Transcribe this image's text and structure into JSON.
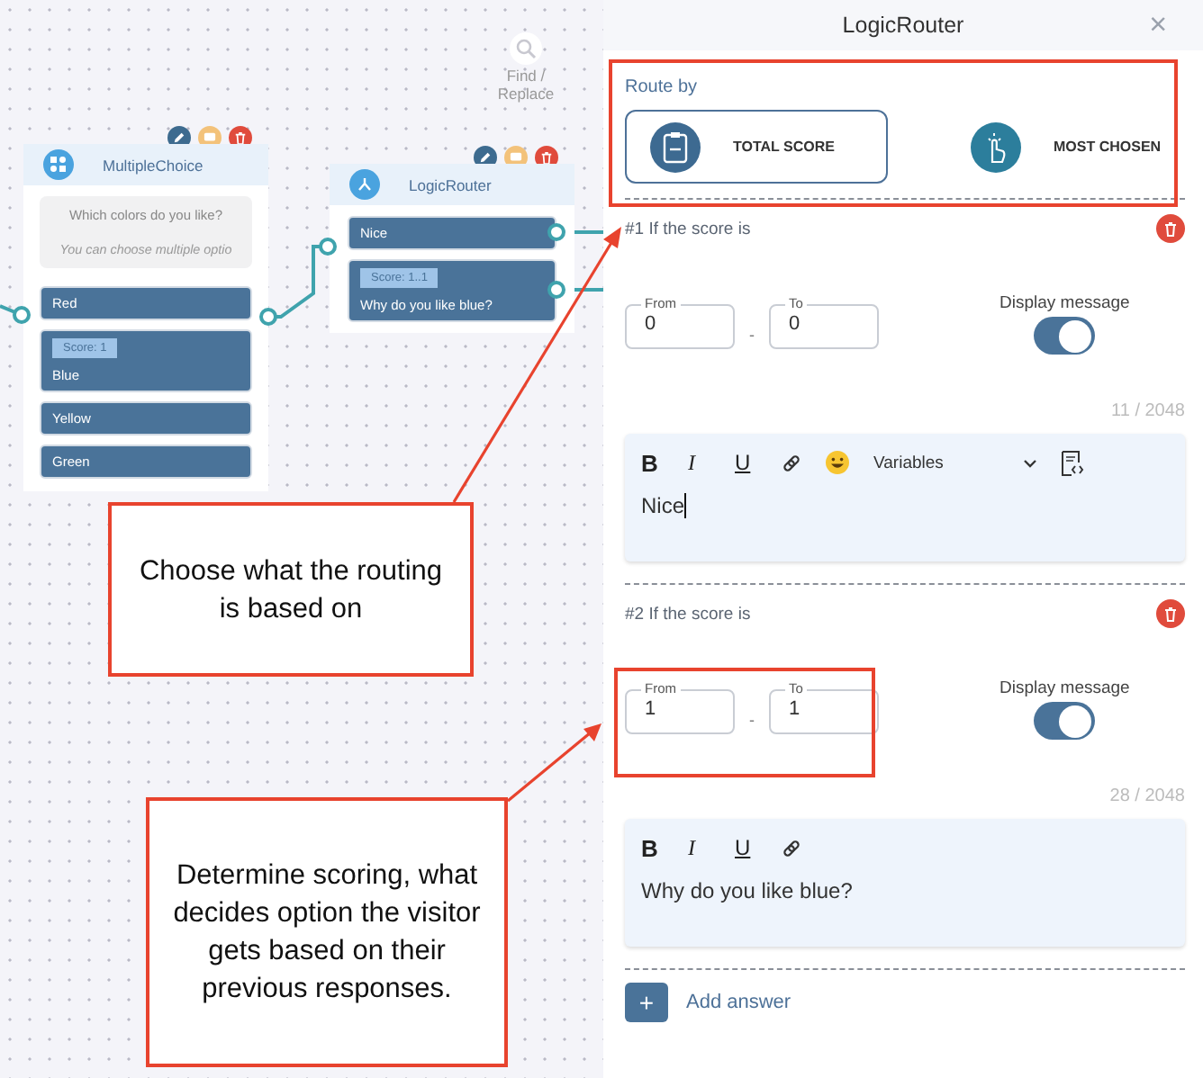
{
  "canvas": {
    "find_replace": "Find / Replace",
    "nodes": [
      {
        "kind": "multiple_choice",
        "title": "MultipleChoice",
        "question": "Which colors do you like?",
        "hint": "You can choose multiple optio",
        "options": [
          {
            "label": "Red"
          },
          {
            "label": "Blue",
            "score": "Score: 1"
          },
          {
            "label": "Yellow"
          },
          {
            "label": "Green"
          }
        ]
      },
      {
        "kind": "logic_router",
        "title": "LogicRouter",
        "options": [
          {
            "label": "Nice"
          },
          {
            "label": "Why do you like blue?",
            "score": "Score: 1..1"
          }
        ]
      }
    ]
  },
  "panel": {
    "title": "LogicRouter",
    "close": "×",
    "route_by": {
      "label": "Route by",
      "options": [
        {
          "kind": "total_score",
          "label": "TOTAL SCORE",
          "selected": true
        },
        {
          "kind": "most_chosen",
          "label": "MOST CHOSEN",
          "selected": false
        }
      ]
    },
    "rules": [
      {
        "heading": "#1 If the score is",
        "from_label": "From",
        "from": "0",
        "to_label": "To",
        "to": "0",
        "separator": "-",
        "display_label": "Display message",
        "display_on": true,
        "counter": "11 / 2048",
        "text": "Nice",
        "focused": true,
        "toolbar": [
          {
            "kind": "bold",
            "label": "B"
          },
          {
            "kind": "italic",
            "label": "I"
          },
          {
            "kind": "underline",
            "label": "U"
          },
          {
            "kind": "link"
          },
          {
            "kind": "emoji"
          },
          {
            "kind": "dropdown",
            "label": "Variables"
          },
          {
            "kind": "code"
          }
        ]
      },
      {
        "heading": "#2 If the score is",
        "from_label": "From",
        "from": "1",
        "to_label": "To",
        "to": "1",
        "separator": "-",
        "display_label": "Display message",
        "display_on": true,
        "counter": "28 / 2048",
        "text": "Why do you like blue?",
        "focused": false,
        "toolbar": [
          {
            "kind": "bold",
            "label": "B"
          },
          {
            "kind": "italic",
            "label": "I"
          },
          {
            "kind": "underline",
            "label": "U"
          },
          {
            "kind": "link"
          }
        ]
      }
    ],
    "add_button": "+",
    "add_label": "Add answer"
  },
  "callouts": [
    "Choose what the routing is based on",
    "Determine scoring, what decides option the visitor gets based on their previous responses."
  ]
}
